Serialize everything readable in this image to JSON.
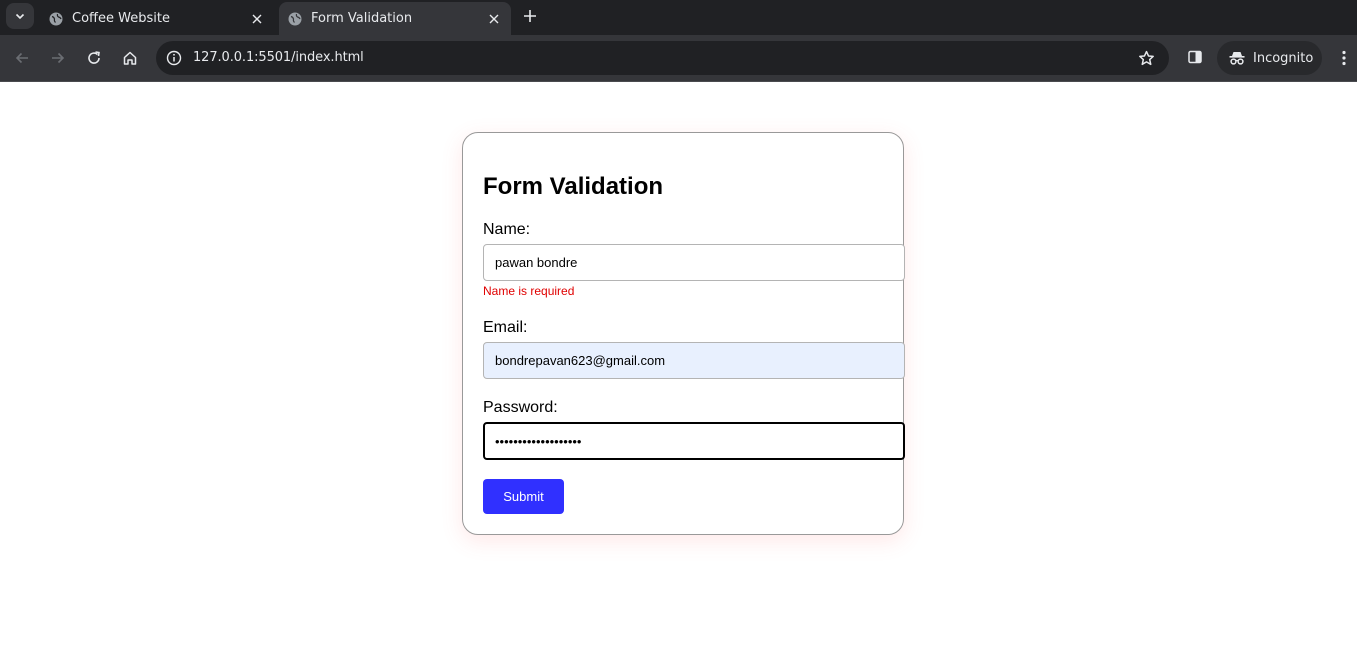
{
  "browser": {
    "tabs": [
      {
        "title": "Coffee Website",
        "active": false,
        "favicon": "globe-icon"
      },
      {
        "title": "Form Validation",
        "active": true,
        "favicon": "globe-icon"
      }
    ],
    "url": "127.0.0.1:5501/index.html",
    "profile_label": "Incognito"
  },
  "form": {
    "title": "Form Validation",
    "name": {
      "label": "Name:",
      "value": "pawan bondre",
      "error": "Name is required"
    },
    "email": {
      "label": "Email:",
      "value": "bondrepavan623@gmail.com"
    },
    "password": {
      "label": "Password:",
      "value": "•••••••••••••••••••"
    },
    "submit_label": "Submit"
  },
  "colors": {
    "submit_bg": "#3030ff",
    "error_text": "#e00000",
    "autofill_bg": "#e8f0fe"
  }
}
